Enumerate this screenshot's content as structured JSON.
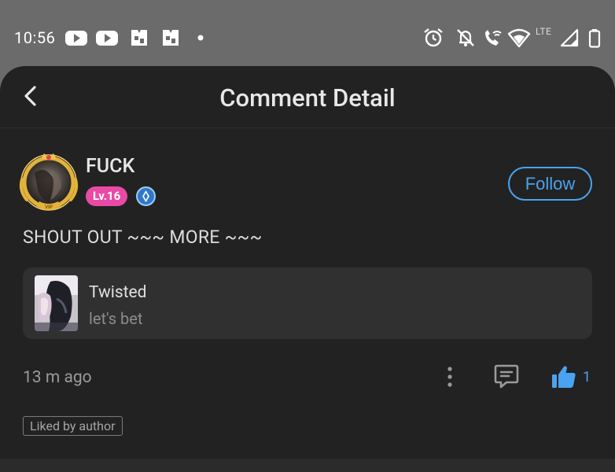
{
  "status_bar": {
    "time": "10:56",
    "network": "LTE",
    "icons": [
      "youtube-icon",
      "youtube-icon",
      "photo-icon",
      "photo-icon",
      "dot-icon",
      "alarm-icon",
      "notifications-off-icon",
      "wifi-call-icon",
      "wifi-icon",
      "cell-signal-icon",
      "battery-icon"
    ]
  },
  "header": {
    "title": "Comment Detail",
    "back_icon": "chevron-left-icon"
  },
  "comment": {
    "username": "FUCK",
    "level": "Lv.16",
    "follow_label": "Follow",
    "text": "SHOUT OUT ~~~ MORE ~~~",
    "timestamp": "13 m ago",
    "like_count": "1",
    "liked_tag": "Liked by author"
  },
  "work": {
    "title": "Twisted",
    "subtitle": "let's bet"
  },
  "colors": {
    "accent": "#4aa3f0",
    "level_badge": "#e94aa5",
    "background": "#222222",
    "card": "#303030"
  }
}
